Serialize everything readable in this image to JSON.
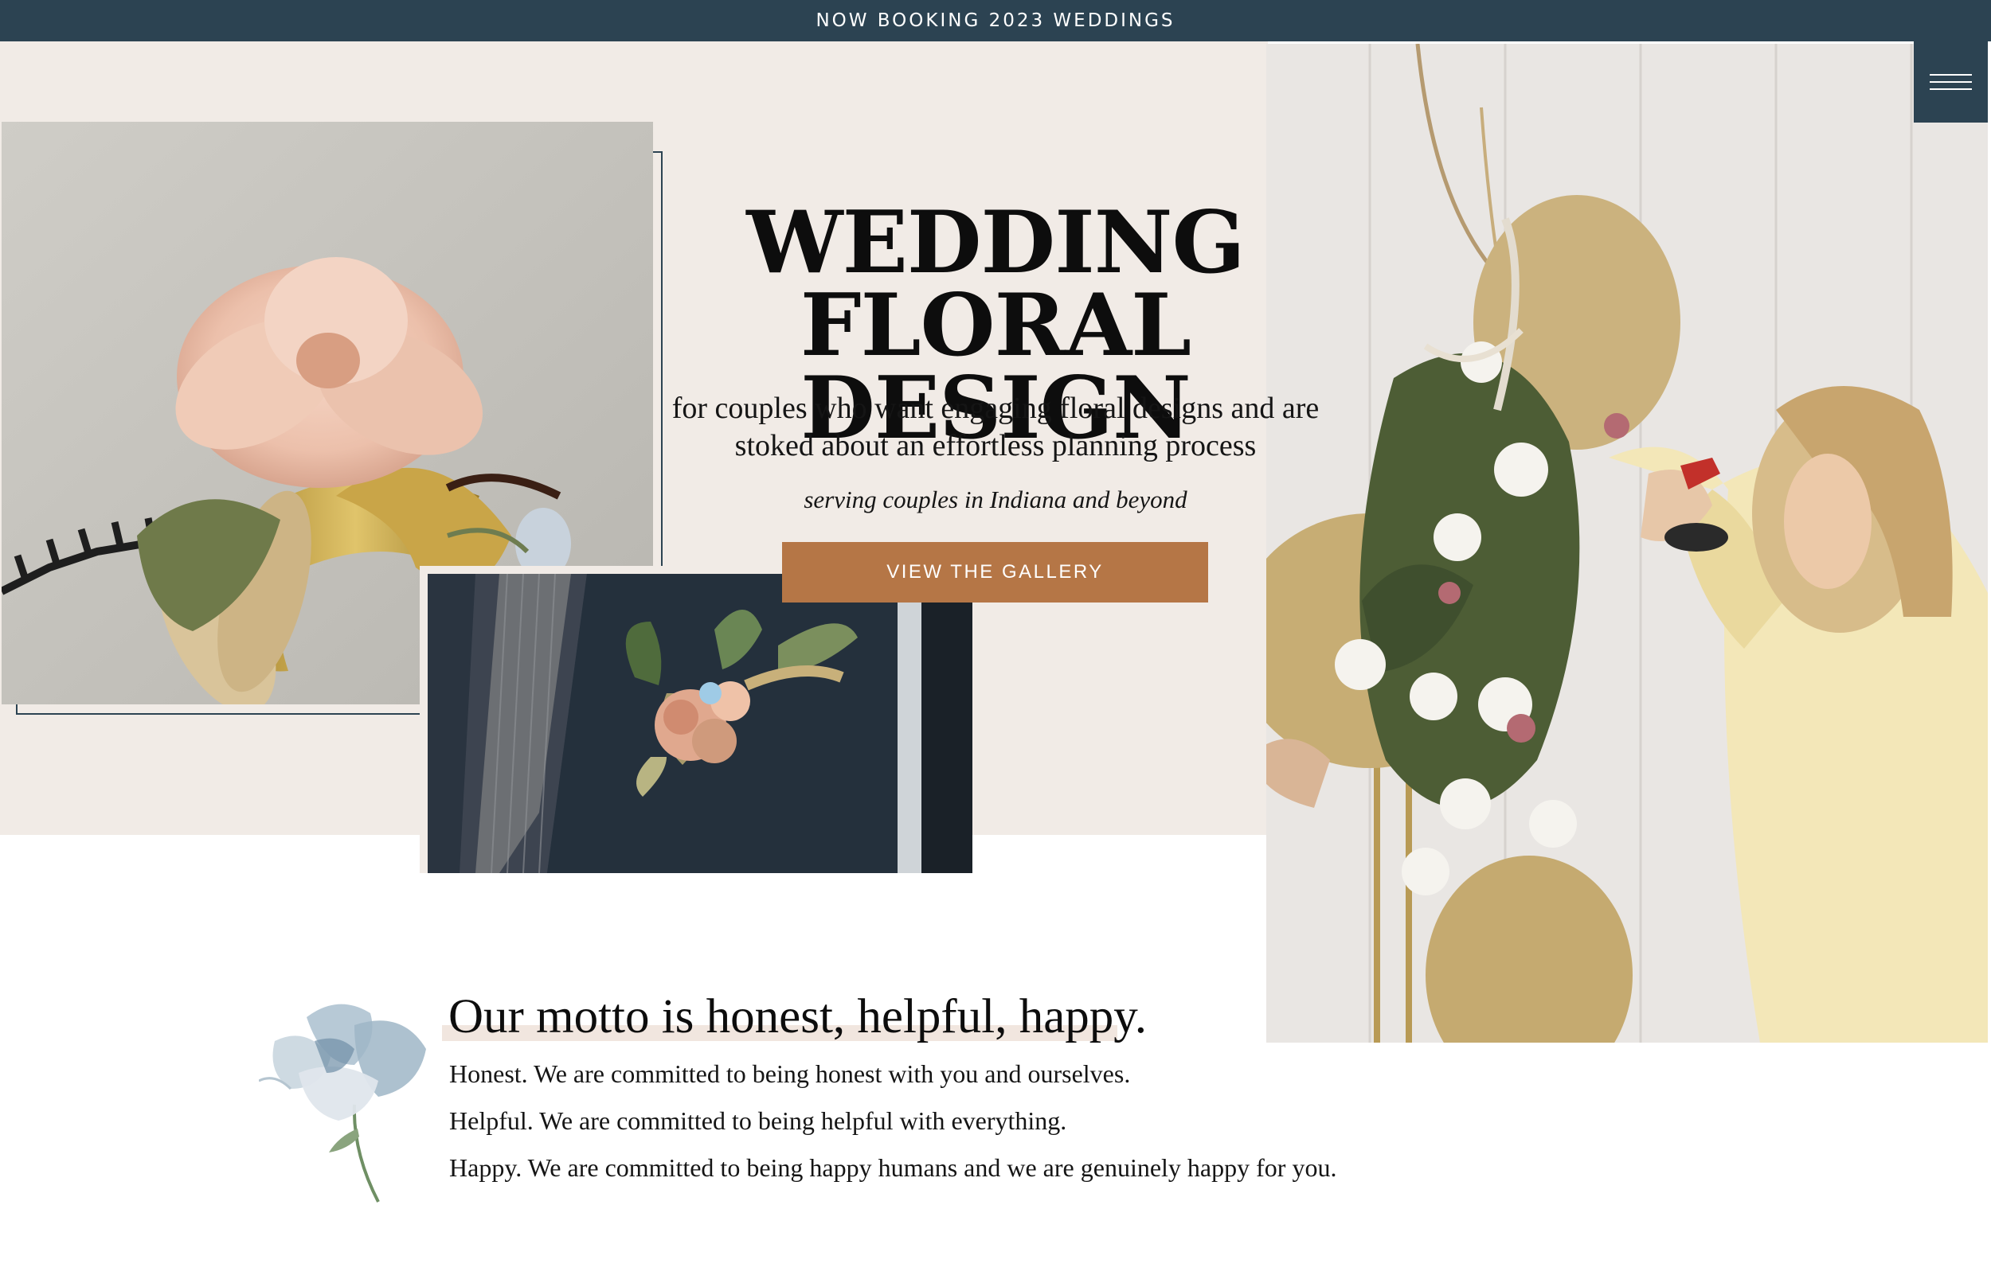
{
  "announcement": {
    "text": "NOW BOOKING 2023 WEDDINGS"
  },
  "hero": {
    "title_line1": "WEDDING FLORAL",
    "title_line2": "DESIGN",
    "subtitle_line1": "for couples who want engaging floral designs and are",
    "subtitle_line2": "stoked about an effortless planning process",
    "serving": "serving couples in Indiana and beyond",
    "cta_label": "VIEW THE GALLERY"
  },
  "motto": {
    "title": "Our motto is honest, helpful, happy.",
    "lines": [
      "Honest. We are committed to being honest with you and ourselves.",
      "Helpful. We are committed to being helpful with everything.",
      "Happy. We are committed to being happy humans and we are genuinely happy for you."
    ]
  },
  "colors": {
    "navy": "#2c4352",
    "cream": "#f1ebe6",
    "copper": "#b57646"
  },
  "icons": {
    "menu": "hamburger-menu-icon",
    "flower": "watercolor-flower-illustration"
  }
}
